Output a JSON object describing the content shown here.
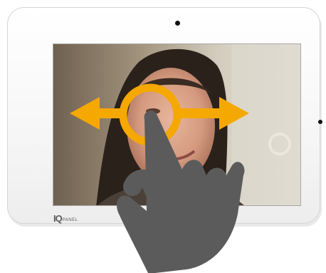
{
  "device": {
    "brand_mark": "IQ",
    "brand_word": "PANEL"
  },
  "gesture": {
    "type": "pinch-zoom / pan",
    "accent_color": "#f5a800",
    "hand_color": "#5b5b5b"
  },
  "icons": {
    "left_arrow": "arrow-left-icon",
    "right_arrow": "arrow-right-icon",
    "ring": "touch-target-ring-icon",
    "hand": "pointing-hand-icon"
  }
}
